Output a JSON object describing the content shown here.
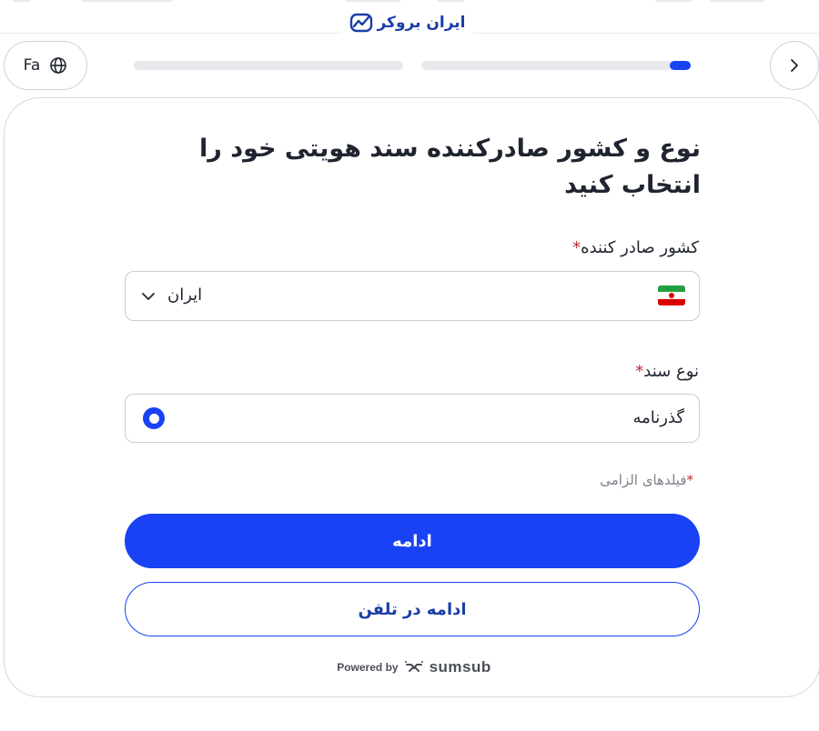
{
  "brand": {
    "name": "ایران بروکر",
    "accent_color": "#1a3ea8"
  },
  "topbar": {
    "language_label": "Fa",
    "language_icon": "globe-icon",
    "back_icon": "chevron-right-icon",
    "progress": {
      "steps": 2,
      "current_step": 2,
      "current_step_fill_fraction": 0.08,
      "fill_color": "#1942f5"
    }
  },
  "form": {
    "title": "نوع و کشور صادرکننده سند هویتی خود را انتخاب کنید",
    "country_field": {
      "label": "کشور صادر کننده",
      "required_marker": "*",
      "selected_value": "ایران",
      "flag_icon": "iran-flag-icon",
      "dropdown_icon": "chevron-down-icon"
    },
    "document_type_field": {
      "label": "نوع سند",
      "required_marker": "*",
      "options": [
        {
          "label": "گذرنامه",
          "selected": true
        }
      ]
    },
    "required_note": {
      "marker": "*",
      "text": "فیلدهای الزامی"
    },
    "continue_button": "ادامه",
    "continue_on_phone_button": "ادامه در تلفن"
  },
  "footer": {
    "powered_by_label": "Powered by",
    "provider_name": "sumsub"
  },
  "colors": {
    "primary": "#1942f5",
    "required": "#c0262d",
    "border": "#c9ccd3"
  }
}
